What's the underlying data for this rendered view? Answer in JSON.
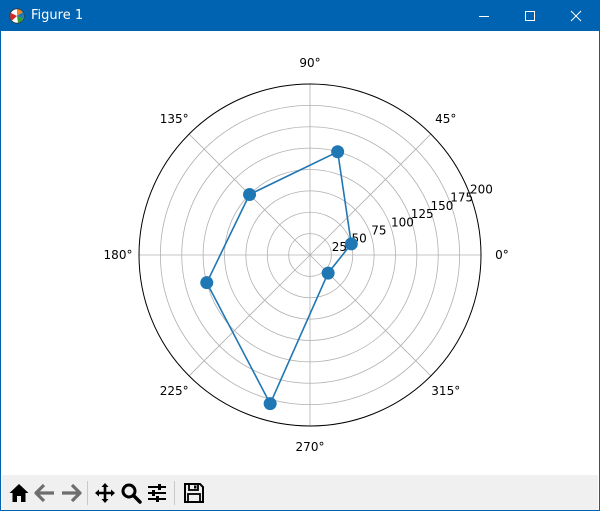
{
  "window": {
    "title": "Figure 1"
  },
  "chart_data": {
    "type": "line",
    "projection": "polar",
    "angle_ticks": [
      "0°",
      "45°",
      "90°",
      "135°",
      "180°",
      "225°",
      "270°",
      "315°"
    ],
    "radial_ticks": [
      "25",
      "50",
      "75",
      "100",
      "125",
      "150",
      "175",
      "200"
    ],
    "rlim": [
      0,
      200
    ],
    "grid": true,
    "series": [
      {
        "color": "#1f77b4",
        "marker": "circle",
        "points": [
          {
            "theta_deg": 15,
            "r": 50
          },
          {
            "theta_deg": 75,
            "r": 125
          },
          {
            "theta_deg": 135,
            "r": 100
          },
          {
            "theta_deg": 195,
            "r": 125
          },
          {
            "theta_deg": 255,
            "r": 180
          },
          {
            "theta_deg": 315,
            "r": 30
          }
        ]
      }
    ]
  },
  "toolbar": {
    "buttons": [
      "home-icon",
      "back-icon",
      "forward-icon",
      "pan-icon",
      "zoom-icon",
      "configure-subplots-icon",
      "save-icon"
    ]
  }
}
